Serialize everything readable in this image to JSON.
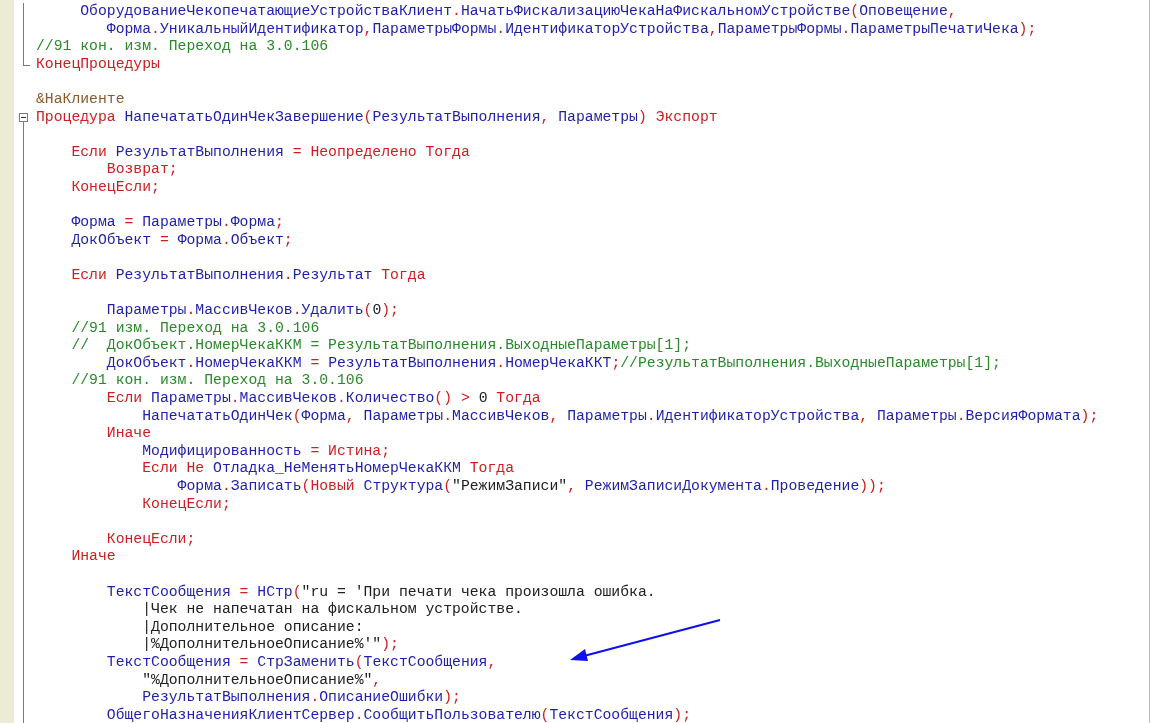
{
  "editor": {
    "lines": [
      {
        "kind": "body",
        "tokens": [
          {
            "kind": "name",
            "text": "     ОборудованиеЧекопечатающиеУстройстваКлиент"
          },
          {
            "kind": "keyword",
            "text": "."
          },
          {
            "kind": "name",
            "text": "НачатьФискализациюЧекаНаФискальномУстройстве"
          },
          {
            "kind": "keyword",
            "text": "("
          },
          {
            "kind": "name",
            "text": "Оповещение"
          },
          {
            "kind": "keyword",
            "text": ","
          }
        ]
      },
      {
        "kind": "body",
        "tokens": [
          {
            "kind": "name",
            "text": "        Форма"
          },
          {
            "kind": "keyword",
            "text": "."
          },
          {
            "kind": "name",
            "text": "УникальныйИдентификатор"
          },
          {
            "kind": "keyword",
            "text": ","
          },
          {
            "kind": "name",
            "text": "ПараметрыФормы"
          },
          {
            "kind": "keyword",
            "text": "."
          },
          {
            "kind": "name",
            "text": "ИдентификаторУстройства"
          },
          {
            "kind": "keyword",
            "text": ","
          },
          {
            "kind": "name",
            "text": "ПараметрыФормы"
          },
          {
            "kind": "keyword",
            "text": "."
          },
          {
            "kind": "name",
            "text": "ПараметрыПечатиЧека"
          },
          {
            "kind": "keyword",
            "text": ");"
          }
        ]
      },
      {
        "kind": "body",
        "tokens": [
          {
            "kind": "comment",
            "text": "//91 кон. изм. Переход на 3.0.106"
          }
        ]
      },
      {
        "kind": "end",
        "tokens": [
          {
            "kind": "keyword",
            "text": "КонецПроцедуры"
          }
        ]
      },
      {
        "kind": "plain"
      },
      {
        "kind": "plain",
        "tokens": [
          {
            "kind": "directive",
            "text": "&НаКлиенте"
          }
        ]
      },
      {
        "kind": "start",
        "tokens": [
          {
            "kind": "keyword",
            "text": "Процедура "
          },
          {
            "kind": "name",
            "text": "НапечататьОдинЧекЗавершение"
          },
          {
            "kind": "keyword",
            "text": "("
          },
          {
            "kind": "name",
            "text": "РезультатВыполнения"
          },
          {
            "kind": "keyword",
            "text": ", "
          },
          {
            "kind": "name",
            "text": "Параметры"
          },
          {
            "kind": "keyword",
            "text": ") Экспорт"
          }
        ]
      },
      {
        "kind": "body"
      },
      {
        "kind": "body",
        "tokens": [
          {
            "kind": "keyword",
            "text": "    Если "
          },
          {
            "kind": "name",
            "text": "РезультатВыполнения "
          },
          {
            "kind": "keyword",
            "text": "= Неопределено Тогда"
          }
        ]
      },
      {
        "kind": "body",
        "tokens": [
          {
            "kind": "keyword",
            "text": "        Возврат;"
          }
        ]
      },
      {
        "kind": "body",
        "tokens": [
          {
            "kind": "keyword",
            "text": "    КонецЕсли;"
          }
        ]
      },
      {
        "kind": "body"
      },
      {
        "kind": "body",
        "tokens": [
          {
            "kind": "name",
            "text": "    Форма "
          },
          {
            "kind": "keyword",
            "text": "= "
          },
          {
            "kind": "name",
            "text": "Параметры"
          },
          {
            "kind": "keyword",
            "text": "."
          },
          {
            "kind": "name",
            "text": "Форма"
          },
          {
            "kind": "keyword",
            "text": ";"
          }
        ]
      },
      {
        "kind": "body",
        "tokens": [
          {
            "kind": "name",
            "text": "    ДокОбъект "
          },
          {
            "kind": "keyword",
            "text": "= "
          },
          {
            "kind": "name",
            "text": "Форма"
          },
          {
            "kind": "keyword",
            "text": "."
          },
          {
            "kind": "name",
            "text": "Объект"
          },
          {
            "kind": "keyword",
            "text": ";"
          }
        ]
      },
      {
        "kind": "body"
      },
      {
        "kind": "body",
        "tokens": [
          {
            "kind": "keyword",
            "text": "    Если "
          },
          {
            "kind": "name",
            "text": "РезультатВыполнения"
          },
          {
            "kind": "keyword",
            "text": "."
          },
          {
            "kind": "name",
            "text": "Результат "
          },
          {
            "kind": "keyword",
            "text": "Тогда"
          }
        ]
      },
      {
        "kind": "body"
      },
      {
        "kind": "body",
        "tokens": [
          {
            "kind": "name",
            "text": "        Параметры"
          },
          {
            "kind": "keyword",
            "text": "."
          },
          {
            "kind": "name",
            "text": "МассивЧеков"
          },
          {
            "kind": "keyword",
            "text": "."
          },
          {
            "kind": "name",
            "text": "Удалить"
          },
          {
            "kind": "keyword",
            "text": "("
          },
          {
            "kind": "literal",
            "text": "0"
          },
          {
            "kind": "keyword",
            "text": ");"
          }
        ]
      },
      {
        "kind": "body",
        "tokens": [
          {
            "kind": "comment",
            "text": "    //91 изм. Переход на 3.0.106"
          }
        ]
      },
      {
        "kind": "body",
        "tokens": [
          {
            "kind": "comment",
            "text": "    //  ДокОбъект.НомерЧекаККМ = РезультатВыполнения.ВыходныеПараметры[1];"
          }
        ]
      },
      {
        "kind": "body",
        "tokens": [
          {
            "kind": "name",
            "text": "        ДокОбъект"
          },
          {
            "kind": "keyword",
            "text": "."
          },
          {
            "kind": "name",
            "text": "НомерЧекаККМ "
          },
          {
            "kind": "keyword",
            "text": "= "
          },
          {
            "kind": "name",
            "text": "РезультатВыполнения"
          },
          {
            "kind": "keyword",
            "text": "."
          },
          {
            "kind": "name",
            "text": "НомерЧекаККТ"
          },
          {
            "kind": "keyword",
            "text": ";"
          },
          {
            "kind": "comment",
            "text": "//РезультатВыполнения.ВыходныеПараметры[1];"
          }
        ]
      },
      {
        "kind": "body",
        "tokens": [
          {
            "kind": "comment",
            "text": "    //91 кон. изм. Переход на 3.0.106"
          }
        ]
      },
      {
        "kind": "body",
        "tokens": [
          {
            "kind": "keyword",
            "text": "        Если "
          },
          {
            "kind": "name",
            "text": "Параметры"
          },
          {
            "kind": "keyword",
            "text": "."
          },
          {
            "kind": "name",
            "text": "МассивЧеков"
          },
          {
            "kind": "keyword",
            "text": "."
          },
          {
            "kind": "name",
            "text": "Количество"
          },
          {
            "kind": "keyword",
            "text": "() > "
          },
          {
            "kind": "literal",
            "text": "0 "
          },
          {
            "kind": "keyword",
            "text": "Тогда"
          }
        ]
      },
      {
        "kind": "body",
        "tokens": [
          {
            "kind": "name",
            "text": "            НапечататьОдинЧек"
          },
          {
            "kind": "keyword",
            "text": "("
          },
          {
            "kind": "name",
            "text": "Форма"
          },
          {
            "kind": "keyword",
            "text": ", "
          },
          {
            "kind": "name",
            "text": "Параметры"
          },
          {
            "kind": "keyword",
            "text": "."
          },
          {
            "kind": "name",
            "text": "МассивЧеков"
          },
          {
            "kind": "keyword",
            "text": ", "
          },
          {
            "kind": "name",
            "text": "Параметры"
          },
          {
            "kind": "keyword",
            "text": "."
          },
          {
            "kind": "name",
            "text": "ИдентификаторУстройства"
          },
          {
            "kind": "keyword",
            "text": ", "
          },
          {
            "kind": "name",
            "text": "Параметры"
          },
          {
            "kind": "keyword",
            "text": "."
          },
          {
            "kind": "name",
            "text": "ВерсияФормата"
          },
          {
            "kind": "keyword",
            "text": ");"
          }
        ]
      },
      {
        "kind": "body",
        "tokens": [
          {
            "kind": "keyword",
            "text": "        Иначе"
          }
        ]
      },
      {
        "kind": "body",
        "tokens": [
          {
            "kind": "name",
            "text": "            Модифицированность "
          },
          {
            "kind": "keyword",
            "text": "= Истина;"
          }
        ]
      },
      {
        "kind": "body",
        "tokens": [
          {
            "kind": "keyword",
            "text": "            Если Не "
          },
          {
            "kind": "name",
            "text": "Отладка_НеМенятьНомерЧекаККМ "
          },
          {
            "kind": "keyword",
            "text": "Тогда"
          }
        ]
      },
      {
        "kind": "body",
        "tokens": [
          {
            "kind": "name",
            "text": "                Форма"
          },
          {
            "kind": "keyword",
            "text": "."
          },
          {
            "kind": "name",
            "text": "Записать"
          },
          {
            "kind": "keyword",
            "text": "(Новый "
          },
          {
            "kind": "name",
            "text": "Структура"
          },
          {
            "kind": "keyword",
            "text": "("
          },
          {
            "kind": "literal",
            "text": "\"РежимЗаписи\""
          },
          {
            "kind": "keyword",
            "text": ", "
          },
          {
            "kind": "name",
            "text": "РежимЗаписиДокумента"
          },
          {
            "kind": "keyword",
            "text": "."
          },
          {
            "kind": "name",
            "text": "Проведение"
          },
          {
            "kind": "keyword",
            "text": "));"
          }
        ]
      },
      {
        "kind": "body",
        "tokens": [
          {
            "kind": "keyword",
            "text": "            КонецЕсли;"
          }
        ]
      },
      {
        "kind": "body"
      },
      {
        "kind": "body",
        "tokens": [
          {
            "kind": "keyword",
            "text": "        КонецЕсли;"
          }
        ]
      },
      {
        "kind": "body",
        "tokens": [
          {
            "kind": "keyword",
            "text": "    Иначе"
          }
        ]
      },
      {
        "kind": "body"
      },
      {
        "kind": "body",
        "tokens": [
          {
            "kind": "name",
            "text": "        ТекстСообщения "
          },
          {
            "kind": "keyword",
            "text": "= "
          },
          {
            "kind": "name",
            "text": "НСтр"
          },
          {
            "kind": "keyword",
            "text": "("
          },
          {
            "kind": "literal",
            "text": "\"ru = 'При печати чека произошла ошибка."
          }
        ]
      },
      {
        "kind": "body",
        "tokens": [
          {
            "kind": "literal",
            "text": "            |Чек не напечатан на фискальном устройстве."
          }
        ]
      },
      {
        "kind": "body",
        "tokens": [
          {
            "kind": "literal",
            "text": "            |Дополнительное описание:"
          }
        ]
      },
      {
        "kind": "body",
        "tokens": [
          {
            "kind": "literal",
            "text": "            |%ДополнительноеОписание%'\""
          },
          {
            "kind": "keyword",
            "text": ");"
          }
        ]
      },
      {
        "kind": "body",
        "tokens": [
          {
            "kind": "name",
            "text": "        ТекстСообщения "
          },
          {
            "kind": "keyword",
            "text": "= "
          },
          {
            "kind": "name",
            "text": "СтрЗаменить"
          },
          {
            "kind": "keyword",
            "text": "("
          },
          {
            "kind": "name",
            "text": "ТекстСообщения"
          },
          {
            "kind": "keyword",
            "text": ","
          }
        ]
      },
      {
        "kind": "body",
        "tokens": [
          {
            "kind": "literal",
            "text": "            \"%ДополнительноеОписание%\""
          },
          {
            "kind": "keyword",
            "text": ","
          }
        ]
      },
      {
        "kind": "body",
        "tokens": [
          {
            "kind": "name",
            "text": "            РезультатВыполнения"
          },
          {
            "kind": "keyword",
            "text": "."
          },
          {
            "kind": "name",
            "text": "ОписаниеОшибки"
          },
          {
            "kind": "keyword",
            "text": ");"
          }
        ]
      },
      {
        "kind": "body",
        "tokens": [
          {
            "kind": "name",
            "text": "        ОбщегоНазначенияКлиентСервер"
          },
          {
            "kind": "keyword",
            "text": "."
          },
          {
            "kind": "name",
            "text": "СообщитьПользователю"
          },
          {
            "kind": "keyword",
            "text": "("
          },
          {
            "kind": "name",
            "text": "ТекстСообщения"
          },
          {
            "kind": "keyword",
            "text": ");"
          }
        ]
      }
    ]
  }
}
